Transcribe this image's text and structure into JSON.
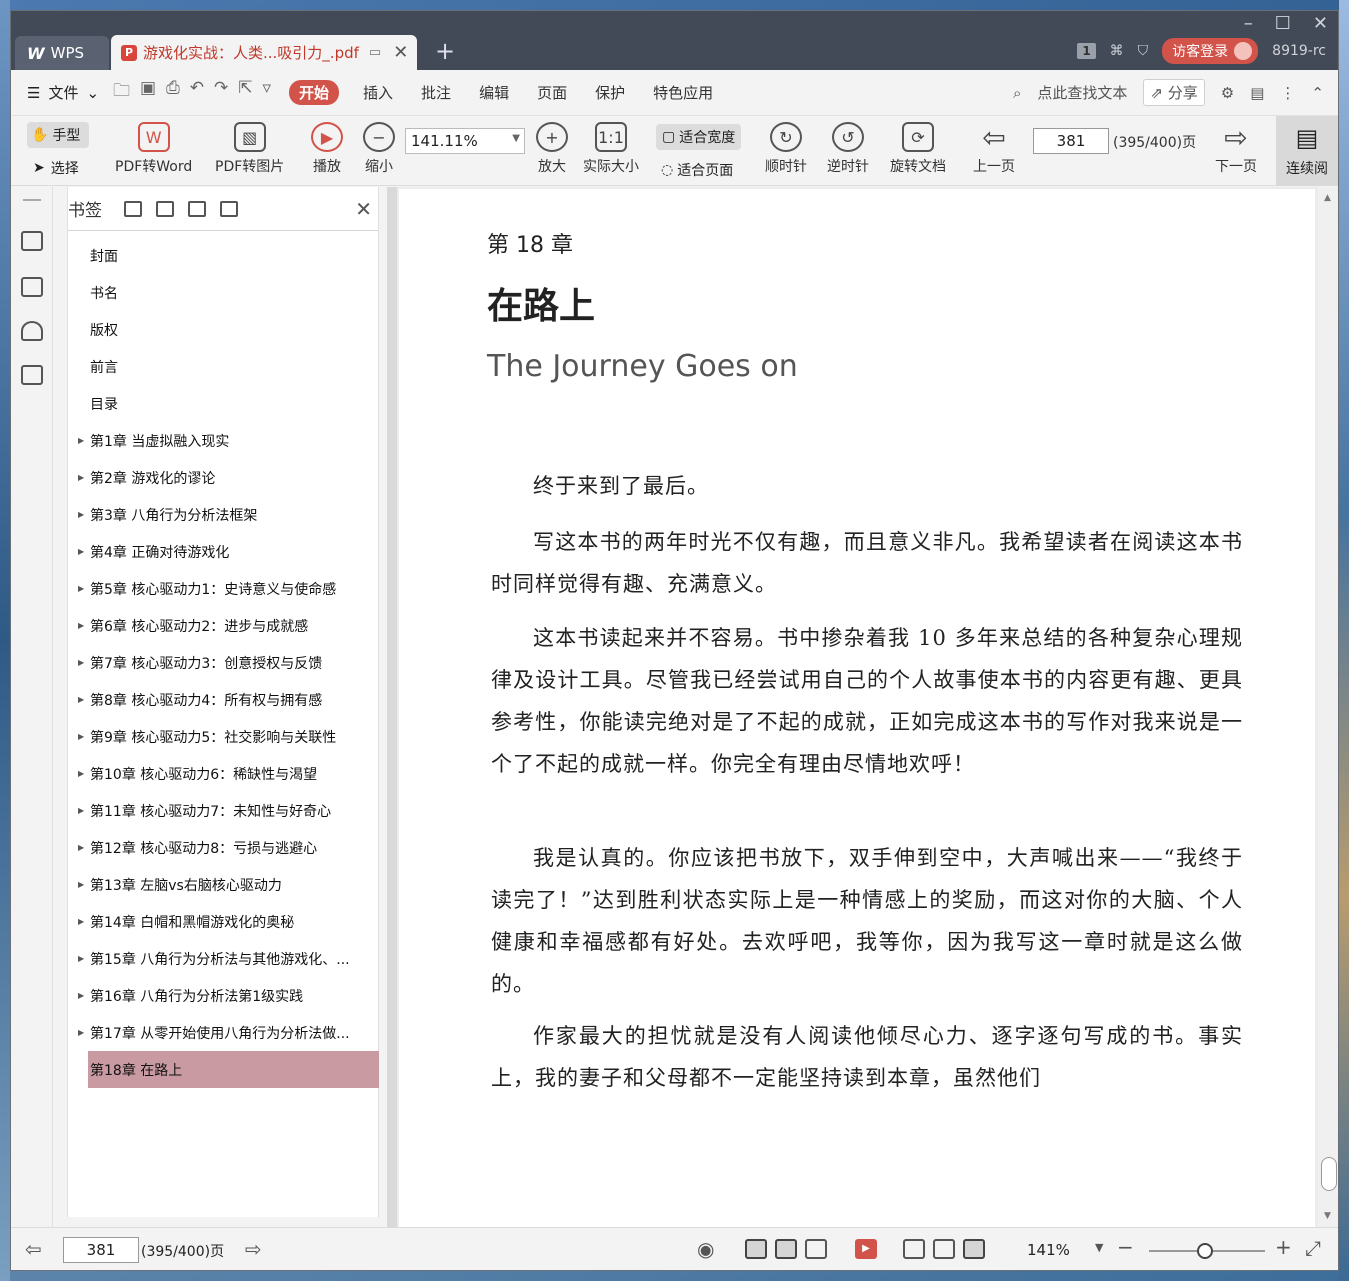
{
  "app": {
    "tab_wps": "WPS",
    "tab_doc_title": "游戏化实战：人类...吸引力_.pdf",
    "badge": "1",
    "visitor_login": "访客登录",
    "version": "8919-rc"
  },
  "menubar": {
    "file": "文件",
    "tabs": [
      "开始",
      "插入",
      "批注",
      "编辑",
      "页面",
      "保护",
      "特色应用"
    ],
    "search": "点此查找文本",
    "share": "分享"
  },
  "toolbar": {
    "hand": "手型",
    "select": "选择",
    "pdf_to_word": "PDF转Word",
    "pdf_to_image": "PDF转图片",
    "play": "播放",
    "zoom_out": "缩小",
    "zoom_value": "141.11%",
    "zoom_in": "放大",
    "actual_size": "实际大小",
    "actual_size_icon": "1:1",
    "fit_width": "适合宽度",
    "fit_page": "适合页面",
    "clockwise": "顺时针",
    "counterclockwise": "逆时针",
    "rotate_doc": "旋转文档",
    "prev_page": "上一页",
    "page_value": "381",
    "page_total": "(395/400)页",
    "next_page": "下一页",
    "continuous": "连续阅"
  },
  "bookmarks": {
    "title": "书签",
    "items": [
      {
        "label": "封面",
        "expandable": false
      },
      {
        "label": "书名",
        "expandable": false
      },
      {
        "label": "版权",
        "expandable": false
      },
      {
        "label": "前言",
        "expandable": false
      },
      {
        "label": "目录",
        "expandable": false
      },
      {
        "label": "第1章  当虚拟融入现实",
        "expandable": true
      },
      {
        "label": "第2章  游戏化的谬论",
        "expandable": true
      },
      {
        "label": "第3章  八角行为分析法框架",
        "expandable": true
      },
      {
        "label": "第4章  正确对待游戏化",
        "expandable": true
      },
      {
        "label": "第5章  核心驱动力1：史诗意义与使命感",
        "expandable": true
      },
      {
        "label": "第6章  核心驱动力2：进步与成就感",
        "expandable": true
      },
      {
        "label": "第7章  核心驱动力3：创意授权与反馈",
        "expandable": true
      },
      {
        "label": "第8章  核心驱动力4：所有权与拥有感",
        "expandable": true
      },
      {
        "label": "第9章  核心驱动力5：社交影响与关联性",
        "expandable": true
      },
      {
        "label": "第10章  核心驱动力6：稀缺性与渴望",
        "expandable": true
      },
      {
        "label": "第11章  核心驱动力7：未知性与好奇心",
        "expandable": true
      },
      {
        "label": "第12章  核心驱动力8：亏损与逃避心",
        "expandable": true
      },
      {
        "label": "第13章  左脑vs右脑核心驱动力",
        "expandable": true
      },
      {
        "label": "第14章  白帽和黑帽游戏化的奥秘",
        "expandable": true
      },
      {
        "label": "第15章  八角行为分析法与其他游戏化、...",
        "expandable": true
      },
      {
        "label": "第16章  八角行为分析法第1级实践",
        "expandable": true
      },
      {
        "label": "第17章  从零开始使用八角行为分析法做...",
        "expandable": true
      }
    ],
    "active": "第18章  在路上"
  },
  "page": {
    "chapter_no": "第 18 章",
    "chapter_title": "在路上",
    "chapter_en": "The Journey Goes on",
    "paragraphs": [
      "终于来到了最后。",
      "写这本书的两年时光不仅有趣，而且意义非凡。我希望读者在阅读这本书时同样觉得有趣、充满意义。",
      "这本书读起来并不容易。书中掺杂着我 10 多年来总结的各种复杂心理规律及设计工具。尽管我已经尝试用自己的个人故事使本书的内容更有趣、更具参考性，你能读完绝对是了不起的成就，正如完成这本书的写作对我来说是一个了不起的成就一样。你完全有理由尽情地欢呼！",
      "我是认真的。你应该把书放下，双手伸到空中，大声喊出来——“我终于读完了！”达到胜利状态实际上是一种情感上的奖励，而这对你的大脑、个人健康和幸福感都有好处。去欢呼吧，我等你，因为我写这一章时就是这么做的。",
      "作家最大的担忧就是没有人阅读他倾尽心力、逐字逐句写成的书。事实上，我的妻子和父母都不一定能坚持读到本章，虽然他们"
    ]
  },
  "statusbar": {
    "page_value": "381",
    "page_total": "(395/400)页",
    "zoom": "141%"
  },
  "colors": {
    "accent": "#d2534a",
    "titlebar": "#434a57",
    "active_bookmark": "#c99aa2"
  }
}
